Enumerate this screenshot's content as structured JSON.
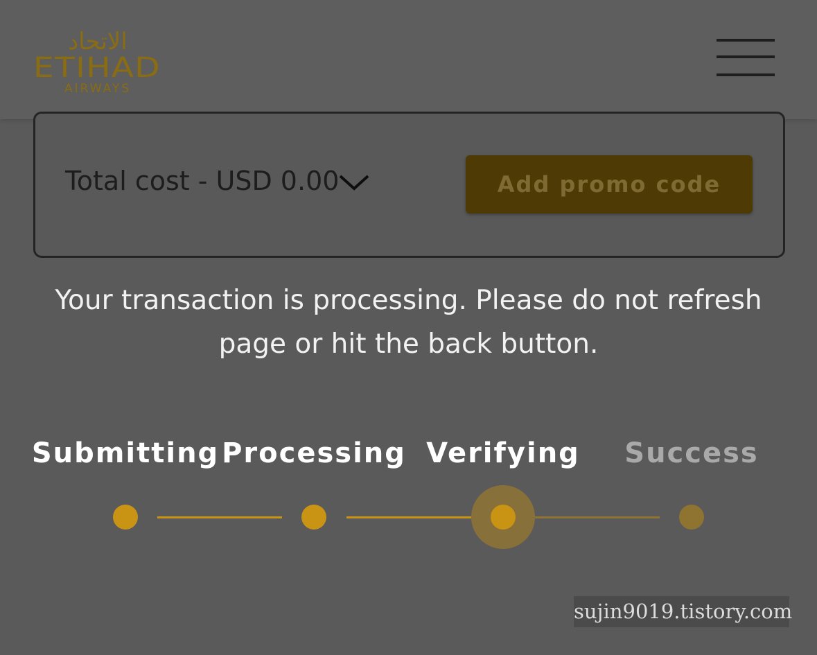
{
  "header": {
    "logo_arabic": "الاتحاد",
    "logo_wordmark": "ETIHAD",
    "logo_subtitle": "AIRWAYS",
    "menu_icon": "hamburger-menu-icon"
  },
  "cost_card": {
    "total_label": "Total cost - USD 0.00",
    "toggle_icon": "chevron-down-icon",
    "promo_button_label": "Add promo code"
  },
  "notice": {
    "text": "Your transaction is processing. Please do not refresh page or hit the back button."
  },
  "progress": {
    "steps": [
      {
        "label": "Submitting",
        "state": "complete"
      },
      {
        "label": "Processing",
        "state": "complete"
      },
      {
        "label": "Verifying",
        "state": "current"
      },
      {
        "label": "Success",
        "state": "pending"
      }
    ]
  },
  "watermark": {
    "text": "sujin9019.tistory.com"
  },
  "colors": {
    "brand_gold": "#c99413",
    "logo_gold": "#8a6c12",
    "overlay_gray": "#5a5a5a"
  }
}
